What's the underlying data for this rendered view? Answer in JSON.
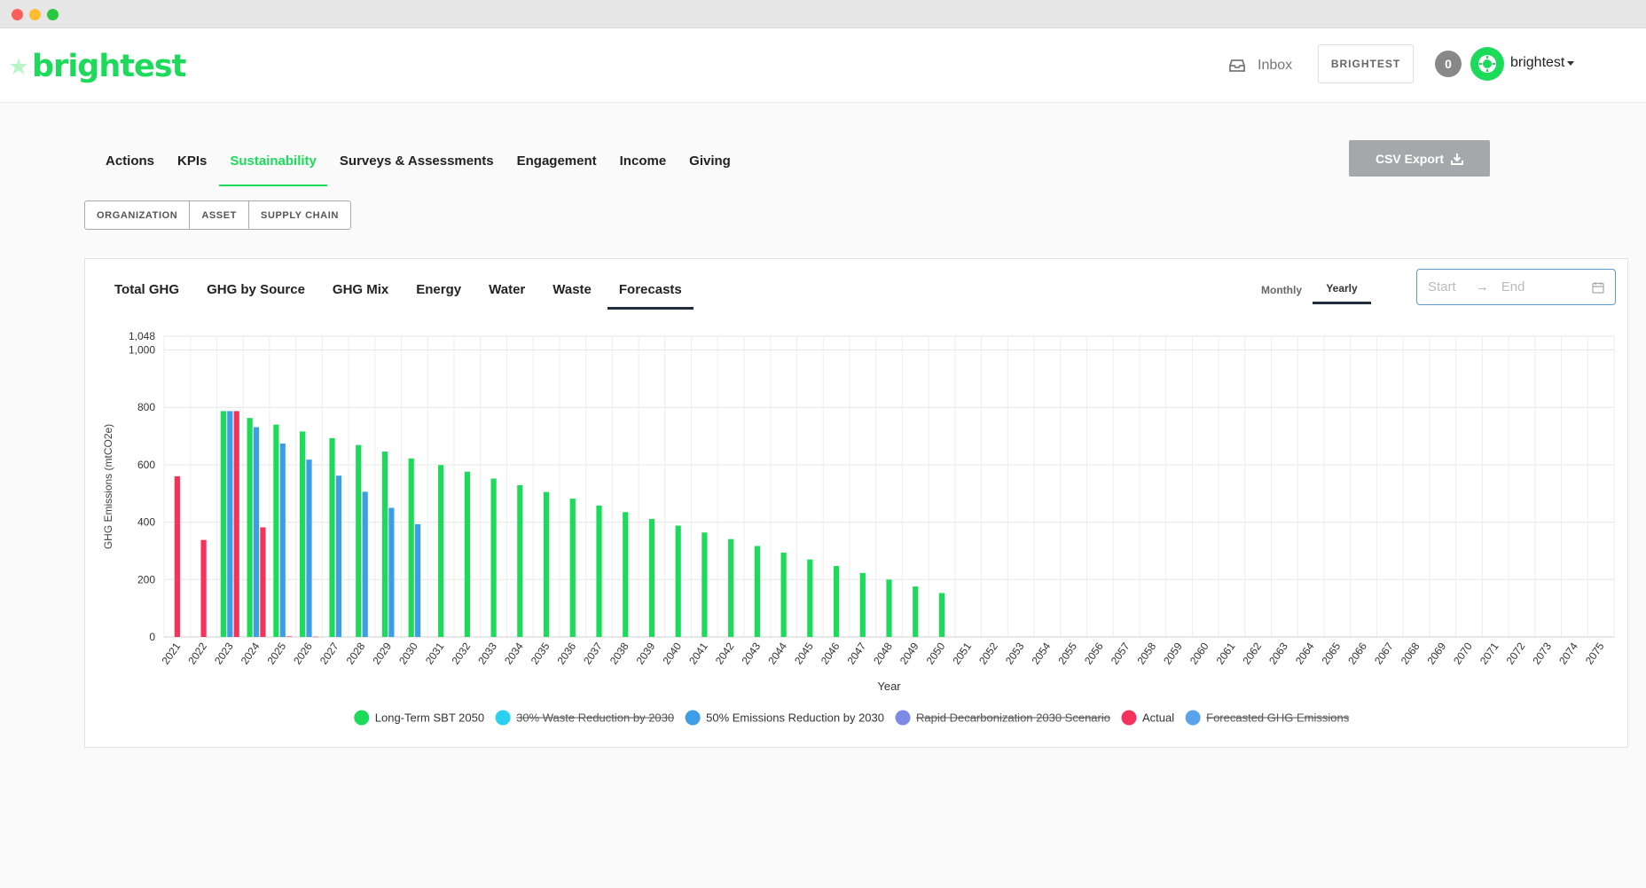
{
  "app": {
    "logo_text": "brightest",
    "inbox_label": "Inbox",
    "org_button": "BRIGHTEST",
    "notification_count": "0",
    "username": "brightest"
  },
  "main_tabs": [
    "Actions",
    "KPIs",
    "Sustainability",
    "Surveys & Assessments",
    "Engagement",
    "Income",
    "Giving"
  ],
  "main_tab_active": "Sustainability",
  "csv_export_label": "CSV Export",
  "scope_buttons": [
    "ORGANIZATION",
    "ASSET",
    "SUPPLY CHAIN"
  ],
  "sub_tabs": [
    "Total GHG",
    "GHG by Source",
    "GHG Mix",
    "Energy",
    "Water",
    "Waste",
    "Forecasts"
  ],
  "sub_tab_active": "Forecasts",
  "period_options": [
    "Monthly",
    "Yearly"
  ],
  "period_active": "Yearly",
  "date_range": {
    "start_placeholder": "Start",
    "end_placeholder": "End",
    "arrow": "→"
  },
  "colors": {
    "brand_green": "#1cdb5a",
    "series_sbt": "#1cdb5a",
    "series_waste": "#2ad0f0",
    "series_fifty": "#3d9de6",
    "series_rapid": "#7d8ae6",
    "series_actual": "#f5325c",
    "series_forecasted": "#5aa3ea"
  },
  "chart_data": {
    "type": "bar",
    "xlabel": "Year",
    "ylabel": "GHG Emissions (mtCO2e)",
    "ylim": [
      0,
      1048
    ],
    "yticks": [
      "0",
      "200",
      "400",
      "600",
      "800",
      "1,000",
      "1,048"
    ],
    "ytick_values": [
      0,
      200,
      400,
      600,
      800,
      1000,
      1048
    ],
    "grid": true,
    "legend_position": "bottom",
    "categories": [
      "2021",
      "2022",
      "2023",
      "2024",
      "2025",
      "2026",
      "2027",
      "2028",
      "2029",
      "2030",
      "2031",
      "2032",
      "2033",
      "2034",
      "2035",
      "2036",
      "2037",
      "2038",
      "2039",
      "2040",
      "2041",
      "2042",
      "2043",
      "2044",
      "2045",
      "2046",
      "2047",
      "2048",
      "2049",
      "2050",
      "2051",
      "2052",
      "2053",
      "2054",
      "2055",
      "2056",
      "2057",
      "2058",
      "2059",
      "2060",
      "2061",
      "2062",
      "2063",
      "2064",
      "2065",
      "2066",
      "2067",
      "2068",
      "2069",
      "2070",
      "2071",
      "2072",
      "2073",
      "2074",
      "2075"
    ],
    "series": [
      {
        "name": "Long-Term SBT 2050",
        "color": "#1cdb5a",
        "hidden": false,
        "values": [
          null,
          null,
          787,
          763,
          740,
          716,
          693,
          669,
          646,
          622,
          599,
          576,
          552,
          529,
          505,
          482,
          458,
          435,
          411,
          388,
          364,
          341,
          317,
          294,
          270,
          247,
          223,
          200,
          176,
          153
        ]
      },
      {
        "name": "30% Waste Reduction by 2030",
        "color": "#2ad0f0",
        "hidden": true,
        "values": []
      },
      {
        "name": "50% Emissions Reduction by 2030",
        "color": "#3d9de6",
        "hidden": false,
        "values": [
          null,
          null,
          787,
          731,
          674,
          618,
          562,
          506,
          450,
          393
        ]
      },
      {
        "name": "Rapid Decarbonization 2030 Scenario",
        "color": "#7d8ae6",
        "hidden": true,
        "values": []
      },
      {
        "name": "Actual",
        "color": "#f5325c",
        "hidden": false,
        "values": [
          560,
          338,
          787,
          382,
          2,
          1
        ]
      },
      {
        "name": "Forecasted GHG Emissions",
        "color": "#5aa3ea",
        "hidden": true,
        "values": []
      }
    ]
  }
}
